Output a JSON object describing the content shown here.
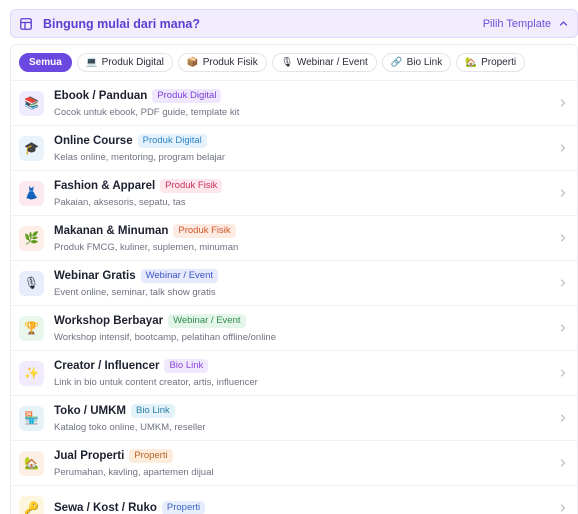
{
  "banner": {
    "title": "Bingung mulai dari mana?",
    "link_label": "Pilih Template",
    "icon": "template-grid-icon",
    "accent": "#5b3fd1"
  },
  "filters": [
    {
      "label": "Semua",
      "icon": "",
      "active": true
    },
    {
      "label": "Produk Digital",
      "icon": "💻",
      "active": false
    },
    {
      "label": "Produk Fisik",
      "icon": "📦",
      "active": false
    },
    {
      "label": "Webinar / Event",
      "icon": "🎙",
      "active": false
    },
    {
      "label": "Bio Link",
      "icon": "🔗",
      "active": false
    },
    {
      "label": "Properti",
      "icon": "🏡",
      "active": false
    }
  ],
  "templates": [
    {
      "title": "Ebook / Panduan",
      "badge": "Produk Digital",
      "desc": "Cocok untuk ebook, PDF guide, template kit",
      "icon": "📚",
      "icon_bg": "#efeafd",
      "badge_bg": "#efe7fd",
      "badge_color": "#7b3fd6"
    },
    {
      "title": "Online Course",
      "badge": "Produk Digital",
      "desc": "Kelas online, mentoring, program belajar",
      "icon": "🎓",
      "icon_bg": "#e9f3fb",
      "badge_bg": "#e5f2fc",
      "badge_color": "#2b86c8"
    },
    {
      "title": "Fashion & Apparel",
      "badge": "Produk Fisik",
      "desc": "Pakaian, aksesoris, sepatu, tas",
      "icon": "👗",
      "icon_bg": "#fce9ef",
      "badge_bg": "#fde6ec",
      "badge_color": "#c7325c"
    },
    {
      "title": "Makanan & Minuman",
      "badge": "Produk Fisik",
      "desc": "Produk FMCG, kuliner, suplemen, minuman",
      "icon": "🌿",
      "icon_bg": "#fdeee7",
      "badge_bg": "#fdeae2",
      "badge_color": "#d2582b"
    },
    {
      "title": "Webinar Gratis",
      "badge": "Webinar / Event",
      "desc": "Event online, seminar, talk show gratis",
      "icon": "🎙",
      "icon_bg": "#e9ecfb",
      "badge_bg": "#e6eafc",
      "badge_color": "#3c55c8"
    },
    {
      "title": "Workshop Berbayar",
      "badge": "Webinar / Event",
      "desc": "Workshop intensif, bootcamp, pelatihan offline/online",
      "icon": "🏆",
      "icon_bg": "#e8f6ec",
      "badge_bg": "#e4f5e9",
      "badge_color": "#2f8f4f"
    },
    {
      "title": "Creator / Influencer",
      "badge": "Bio Link",
      "desc": "Link in bio untuk content creator, artis, influencer",
      "icon": "✨",
      "icon_bg": "#f1ebfd",
      "badge_bg": "#f0e8fd",
      "badge_color": "#8a45d8"
    },
    {
      "title": "Toko / UMKM",
      "badge": "Bio Link",
      "desc": "Katalog toko online, UMKM, reseller",
      "icon": "🏪",
      "icon_bg": "#e7f2f8",
      "badge_bg": "#e3f1f9",
      "badge_color": "#2a7fa8"
    },
    {
      "title": "Jual Properti",
      "badge": "Properti",
      "desc": "Perumahan, kavling, apartemen dijual",
      "icon": "🏡",
      "icon_bg": "#fcefe5",
      "badge_bg": "#fdebdc",
      "badge_color": "#b86522"
    },
    {
      "title": "Sewa / Kost / Ruko",
      "badge": "Properti",
      "desc": "",
      "icon": "🔑",
      "icon_bg": "#fdf5de",
      "badge_bg": "#e6eefc",
      "badge_color": "#3e64c4"
    }
  ]
}
